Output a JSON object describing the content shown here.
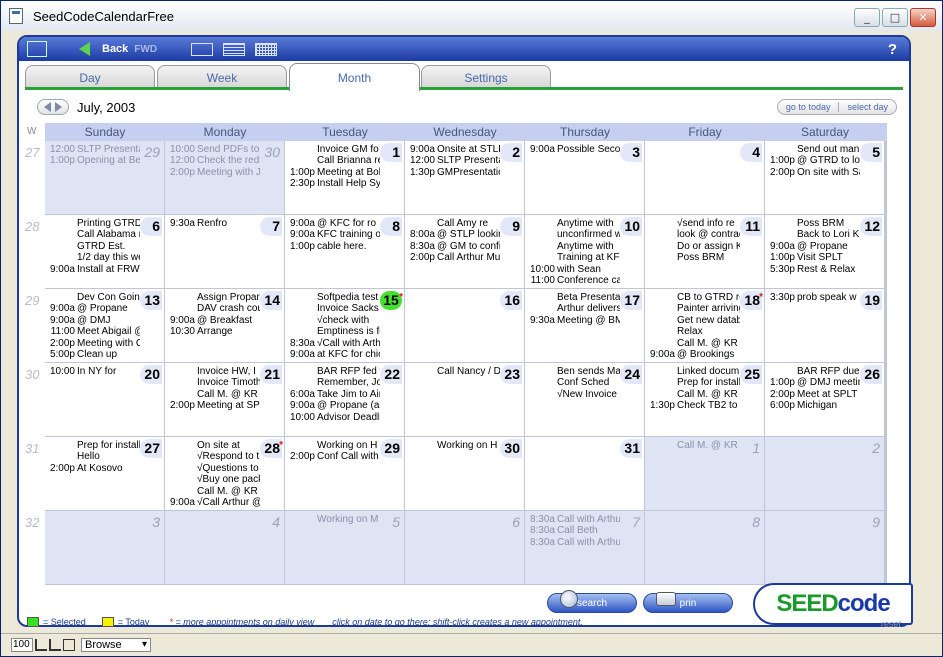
{
  "window": {
    "title": "SeedCodeCalendarFree",
    "min": "_",
    "max": "□",
    "close": "✕"
  },
  "toolbar": {
    "back": "Back",
    "fwd": "FWD",
    "help": "?"
  },
  "tabs": [
    {
      "label": "Day"
    },
    {
      "label": "Week"
    },
    {
      "label": "Month"
    },
    {
      "label": "Settings"
    }
  ],
  "nav": {
    "title": "July, 2003",
    "go_today": "go to today",
    "select_day": "select day"
  },
  "week_label": "W",
  "weeks": [
    "27",
    "28",
    "29",
    "30",
    "31",
    "32"
  ],
  "days_of_week": [
    "Sunday",
    "Monday",
    "Tuesday",
    "Wednesday",
    "Thursday",
    "Friday",
    "Saturday"
  ],
  "cells": [
    {
      "day": "29",
      "other": true,
      "appts": [
        {
          "t": "12:00",
          "x": "SLTP Presentat"
        },
        {
          "t": "1:00p",
          "x": "Opening at Bel"
        }
      ]
    },
    {
      "day": "30",
      "other": true,
      "appts": [
        {
          "t": "10:00",
          "x": "Send PDFs to A"
        },
        {
          "t": "12:00",
          "x": "Check the redfront"
        },
        {
          "t": "2:00p",
          "x": "Meeting with JR"
        }
      ]
    },
    {
      "day": "1",
      "appts": [
        {
          "t": "",
          "x": "Invoice GM fo"
        },
        {
          "t": "",
          "x": "Call Brianna re"
        },
        {
          "t": "1:00p",
          "x": "Meeting at Bob"
        },
        {
          "t": "2:30p",
          "x": "Install Help System"
        }
      ]
    },
    {
      "day": "2",
      "appts": [
        {
          "t": "9:00a",
          "x": "Onsite at STLP"
        },
        {
          "t": "12:00",
          "x": "SLTP Presentation"
        },
        {
          "t": "1:30p",
          "x": "GMPresentation"
        }
      ]
    },
    {
      "day": "3",
      "appts": [
        {
          "t": "9:00a",
          "x": "Possible Secon"
        }
      ]
    },
    {
      "day": "4",
      "appts": []
    },
    {
      "day": "5",
      "appts": [
        {
          "t": "",
          "x": "Send out man"
        },
        {
          "t": "1:00p",
          "x": "@ GTRD to look at"
        },
        {
          "t": "2:00p",
          "x": "On site with Sacks"
        }
      ]
    },
    {
      "day": "6",
      "appts": [
        {
          "t": "",
          "x": "Printing GTRD"
        },
        {
          "t": "",
          "x": "Call Alabama re"
        },
        {
          "t": "",
          "x": "GTRD Est."
        },
        {
          "t": "",
          "x": "1/2 day this week"
        },
        {
          "t": "9:00a",
          "x": "Install at FRWW"
        }
      ]
    },
    {
      "day": "7",
      "appts": [
        {
          "t": "9:30a",
          "x": "Renfro"
        }
      ]
    },
    {
      "day": "8",
      "appts": [
        {
          "t": "9:00a",
          "x": "@ KFC for ro"
        },
        {
          "t": "9:00a",
          "x": "KFC training on"
        },
        {
          "t": "1:00p",
          "x": "cable here."
        }
      ]
    },
    {
      "day": "9",
      "appts": [
        {
          "t": "",
          "x": "Call Amy re"
        },
        {
          "t": "8:00a",
          "x": "@ STLP looking"
        },
        {
          "t": "8:30a",
          "x": "@ GM to config"
        },
        {
          "t": "2:00p",
          "x": "Call Arthur Murray"
        }
      ]
    },
    {
      "day": "10",
      "appts": [
        {
          "t": "",
          "x": "Anytime with"
        },
        {
          "t": "",
          "x": "unconfirmed with"
        },
        {
          "t": "",
          "x": "Anytime with"
        },
        {
          "t": "",
          "x": "Training at KFC"
        },
        {
          "t": "10:00",
          "x": "with Sean"
        },
        {
          "t": "11:00",
          "x": "Conference call"
        }
      ]
    },
    {
      "day": "11",
      "appts": [
        {
          "t": "",
          "x": "√send info re"
        },
        {
          "t": "",
          "x": "look @ contract"
        },
        {
          "t": "",
          "x": "Do or assign KFC"
        },
        {
          "t": "",
          "x": "Poss BRM"
        }
      ]
    },
    {
      "day": "12",
      "appts": [
        {
          "t": "",
          "x": "Poss BRM"
        },
        {
          "t": "",
          "x": "Back to Lori K. at"
        },
        {
          "t": "9:00a",
          "x": "@ Propane"
        },
        {
          "t": "1:00p",
          "x": "Visit SPLT"
        },
        {
          "t": "5:30p",
          "x": "Rest & Relax"
        }
      ]
    },
    {
      "day": "13",
      "appts": [
        {
          "t": "",
          "x": "Dev Con Goin"
        },
        {
          "t": "9:00a",
          "x": "@ Propane"
        },
        {
          "t": "9:00a",
          "x": "@ DMJ"
        },
        {
          "t": "11:00",
          "x": "Meet Abigail @"
        },
        {
          "t": "2:00p",
          "x": "Meeting with CFC"
        },
        {
          "t": "5:00p",
          "x": "Clean up"
        }
      ]
    },
    {
      "day": "14",
      "appts": [
        {
          "t": "",
          "x": "Assign Propan"
        },
        {
          "t": "",
          "x": "DAV crash course"
        },
        {
          "t": "9:00a",
          "x": "@ Breakfast"
        },
        {
          "t": "10:30",
          "x": "Arrange"
        }
      ]
    },
    {
      "day": "15",
      "today": true,
      "more": true,
      "appts": [
        {
          "t": "",
          "x": "Softpedia test"
        },
        {
          "t": "",
          "x": "Invoice Sacks"
        },
        {
          "t": "",
          "x": "√check with"
        },
        {
          "t": "",
          "x": "Emptiness is form"
        },
        {
          "t": "8:30a",
          "x": "√Call with Arthur"
        },
        {
          "t": "9:00a",
          "x": "at KFC for chicken"
        }
      ]
    },
    {
      "day": "16",
      "appts": []
    },
    {
      "day": "17",
      "appts": [
        {
          "t": "",
          "x": "Beta Presentat"
        },
        {
          "t": "",
          "x": "Arthur delivers"
        },
        {
          "t": "9:30a",
          "x": "Meeting @ BMC"
        }
      ]
    },
    {
      "day": "18",
      "more": true,
      "appts": [
        {
          "t": "",
          "x": "CB to GTRD re"
        },
        {
          "t": "",
          "x": "Painter arriving"
        },
        {
          "t": "",
          "x": "Get new database"
        },
        {
          "t": "",
          "x": "Relax"
        },
        {
          "t": "",
          "x": "Call M. @ KR"
        },
        {
          "t": "9:00a",
          "x": "@ Brookings"
        }
      ]
    },
    {
      "day": "19",
      "appts": [
        {
          "t": "3:30p",
          "x": "prob speak w"
        }
      ]
    },
    {
      "day": "20",
      "appts": [
        {
          "t": "10:00",
          "x": "In NY for"
        }
      ]
    },
    {
      "day": "21",
      "appts": [
        {
          "t": "",
          "x": "Invoice HW, I"
        },
        {
          "t": "",
          "x": "Invoice Timothy,"
        },
        {
          "t": "",
          "x": "Call M. @ KR"
        },
        {
          "t": "2:00p",
          "x": "Meeting at SPLT to"
        }
      ]
    },
    {
      "day": "22",
      "appts": [
        {
          "t": "",
          "x": "BAR RFP fed w"
        },
        {
          "t": "",
          "x": "Remember, John"
        },
        {
          "t": "6:00a",
          "x": "Take Jim to Airport"
        },
        {
          "t": "9:00a",
          "x": "@ Propane (all"
        },
        {
          "t": "10:00",
          "x": "Advisor Deadline"
        }
      ]
    },
    {
      "day": "23",
      "appts": [
        {
          "t": "",
          "x": "Call Nancy / D"
        }
      ]
    },
    {
      "day": "24",
      "appts": [
        {
          "t": "",
          "x": "Ben sends Ma"
        },
        {
          "t": "",
          "x": "Conf Sched"
        },
        {
          "t": "",
          "x": "√New Invoice out"
        }
      ]
    },
    {
      "day": "25",
      "appts": [
        {
          "t": "",
          "x": "Linked docum"
        },
        {
          "t": "",
          "x": "Prep for installation"
        },
        {
          "t": "",
          "x": "Call M. @ KR"
        },
        {
          "t": "1:30p",
          "x": "Check TB2 to KFC"
        }
      ]
    },
    {
      "day": "26",
      "appts": [
        {
          "t": "",
          "x": "BAR RFP due"
        },
        {
          "t": "1:00p",
          "x": "@ DMJ meeting"
        },
        {
          "t": "2:00p",
          "x": "Meet at SPLT /w"
        },
        {
          "t": "6:00p",
          "x": "Michigan"
        }
      ]
    },
    {
      "day": "27",
      "appts": [
        {
          "t": "",
          "x": "Prep for install"
        },
        {
          "t": "",
          "x": "Hello"
        },
        {
          "t": "2:00p",
          "x": "At Kosovo"
        }
      ]
    },
    {
      "day": "28",
      "more": true,
      "appts": [
        {
          "t": "",
          "x": "On site at"
        },
        {
          "t": "",
          "x": "√Respond to the"
        },
        {
          "t": "",
          "x": "√Questions to"
        },
        {
          "t": "",
          "x": "√Buy one pack"
        },
        {
          "t": "",
          "x": "Call M. @ KR"
        },
        {
          "t": "9:00a",
          "x": "√Call Arthur @"
        }
      ]
    },
    {
      "day": "29",
      "appts": [
        {
          "t": "",
          "x": "Working on H"
        },
        {
          "t": "2:00p",
          "x": "Conf Call with"
        }
      ]
    },
    {
      "day": "30",
      "appts": [
        {
          "t": "",
          "x": "Working on H"
        }
      ]
    },
    {
      "day": "31",
      "appts": []
    },
    {
      "day": "1",
      "other": true,
      "appts": [
        {
          "t": "",
          "x": "Call M. @ KR"
        }
      ]
    },
    {
      "day": "2",
      "other": true,
      "appts": []
    },
    {
      "day": "3",
      "other": true,
      "appts": []
    },
    {
      "day": "4",
      "other": true,
      "appts": []
    },
    {
      "day": "5",
      "other": true,
      "appts": [
        {
          "t": "",
          "x": "Working on M"
        }
      ]
    },
    {
      "day": "6",
      "other": true,
      "appts": []
    },
    {
      "day": "7",
      "other": true,
      "appts": [
        {
          "t": "8:30a",
          "x": "Call with Arthu"
        },
        {
          "t": "8:30a",
          "x": "Call Beth"
        },
        {
          "t": "8:30a",
          "x": "Call with Arthur"
        }
      ]
    },
    {
      "day": "8",
      "other": true,
      "appts": []
    },
    {
      "day": "9",
      "other": true,
      "appts": []
    }
  ],
  "legend": {
    "selected": "= Selected",
    "today": "= Today",
    "star": "*",
    "more": "= more appointments on daily view",
    "hint": "click on date to go there; shift-click creates a new appointment."
  },
  "actions": {
    "search": "search",
    "print": "prin"
  },
  "brand": {
    "seed": "SEED",
    "code": "code"
  },
  "reset": "reset",
  "status": {
    "zoom": "100",
    "mode": "Browse"
  },
  "colors": {
    "toolbar": "#1c3aa4",
    "today": "#44e030",
    "tab_accent": "#29a13a",
    "brand_green": "#1a9a2a",
    "brand_blue": "#1a3aa8"
  }
}
